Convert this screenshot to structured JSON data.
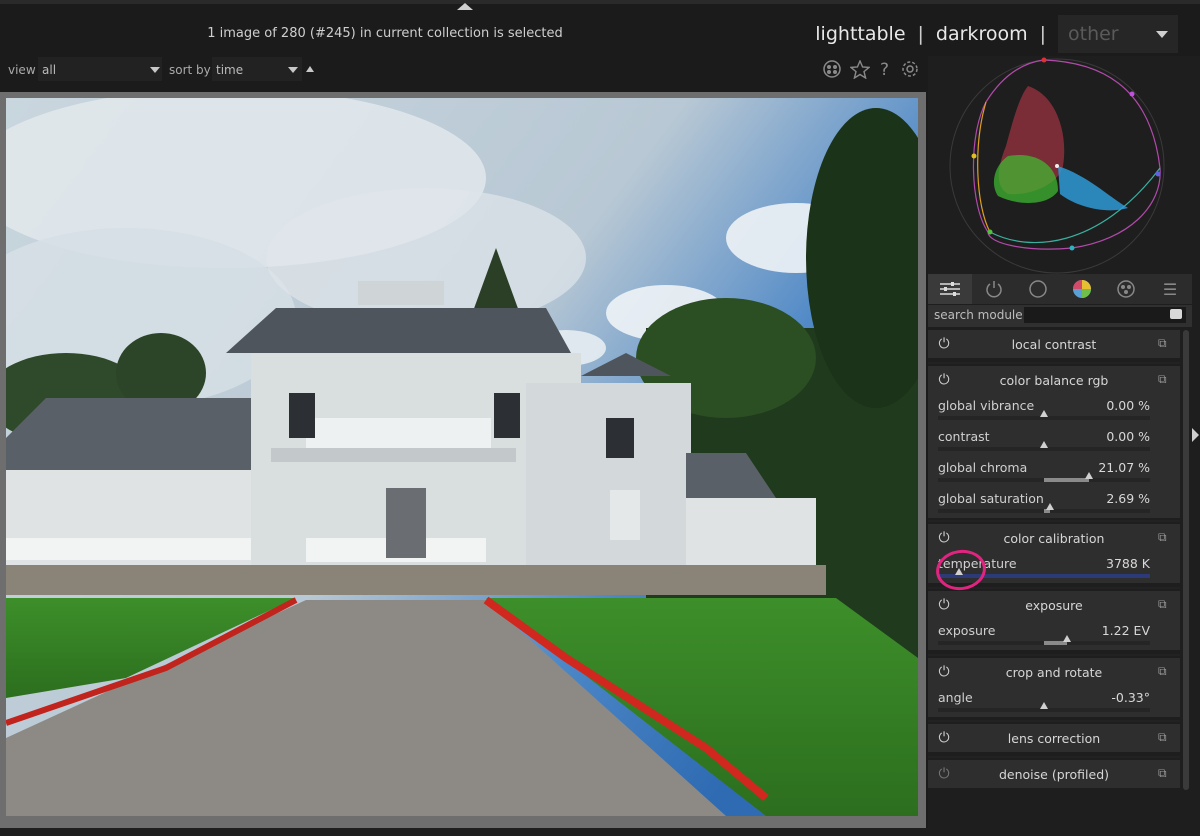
{
  "header": {
    "status_text": "1 image of 280 (#245) in current collection is selected",
    "views": [
      "lighttable",
      "darkroom",
      "other"
    ],
    "separator": "|"
  },
  "filterbar": {
    "view_label": "view",
    "view_value": "all",
    "sort_label": "sort by",
    "sort_value": "time"
  },
  "toolbar_icons": [
    "color-labels-icon",
    "star-icon",
    "help-icon",
    "gear-icon"
  ],
  "right_panel": {
    "tabs": [
      "active-modules-icon",
      "power-icon",
      "base-icon",
      "color-icon",
      "effects-icon",
      "menu-icon"
    ],
    "search_label": "search module",
    "search_value": "",
    "modules": [
      {
        "title": "local contrast",
        "sliders": []
      },
      {
        "title": "color balance rgb",
        "sliders": [
          {
            "label": "global vibrance",
            "value": "0.00 %",
            "fraction": 0.5
          },
          {
            "label": "contrast",
            "value": "0.00 %",
            "fraction": 0.5
          },
          {
            "label": "global chroma",
            "value": "21.07 %",
            "fraction": 0.71
          },
          {
            "label": "global saturation",
            "value": "2.69 %",
            "fraction": 0.53
          }
        ]
      },
      {
        "title": "color calibration",
        "sliders": [
          {
            "label": "temperature",
            "value": "3788 K",
            "fraction": 0.1
          }
        ]
      },
      {
        "title": "exposure",
        "sliders": [
          {
            "label": "exposure",
            "value": "1.22 EV",
            "fraction": 0.61
          }
        ]
      },
      {
        "title": "crop and rotate",
        "sliders": [
          {
            "label": "angle",
            "value": "-0.33°",
            "fraction": 0.5
          }
        ]
      },
      {
        "title": "lens correction",
        "sliders": []
      },
      {
        "title": "denoise (profiled)",
        "sliders": []
      }
    ]
  },
  "colors": {
    "background": "#1b1b1b",
    "panel": "#2e2e2e",
    "highlight_circle": "#e0247f",
    "temperature_bar": "#2c3a78"
  }
}
